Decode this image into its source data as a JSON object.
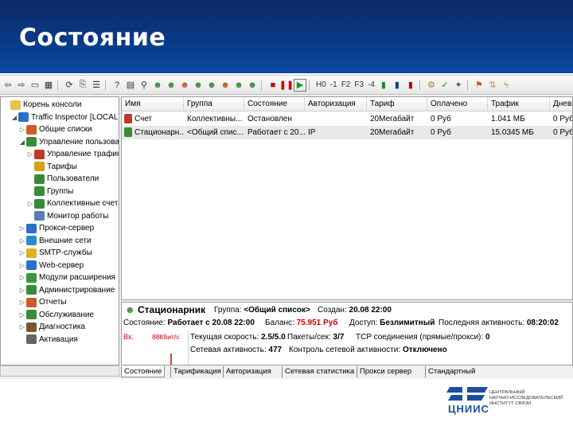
{
  "slide_title": "Состояние",
  "toolbar": {
    "items": [
      "H0",
      "-1",
      "F2",
      "F3",
      "-4"
    ]
  },
  "tree": {
    "items": [
      {
        "label": "Корень консоли",
        "icon": "folder-icon",
        "color": "#e8c44a"
      },
      {
        "label": "Traffic Inspector [LOCAL]",
        "icon": "shield-icon",
        "color": "#2a6fc9"
      },
      {
        "label": "Общие списки",
        "icon": "users-icon",
        "color": "#d05a2a"
      },
      {
        "label": "Управление пользовате",
        "icon": "users-icon",
        "color": "#3a8a3a"
      },
      {
        "label": "Управление трафик",
        "icon": "traffic-icon",
        "color": "#c0392b"
      },
      {
        "label": "Тарифы",
        "icon": "tariff-icon",
        "color": "#d4a017"
      },
      {
        "label": "Пользователи",
        "icon": "user-icon",
        "color": "#3a8a3a"
      },
      {
        "label": "Группы",
        "icon": "group-icon",
        "color": "#3a8a3a"
      },
      {
        "label": "Коллективные счета",
        "icon": "collective-icon",
        "color": "#3a8a3a"
      },
      {
        "label": "Монитор работы",
        "icon": "monitor-icon",
        "color": "#5a7fb5"
      },
      {
        "label": "Прокси-сервер",
        "icon": "proxy-icon",
        "color": "#2a6fc9"
      },
      {
        "label": "Внешние сети",
        "icon": "globe-icon",
        "color": "#2a8ad0"
      },
      {
        "label": "SMTP-службы",
        "icon": "mail-icon",
        "color": "#e0b020"
      },
      {
        "label": "Web-сервер",
        "icon": "web-icon",
        "color": "#2a6fc9"
      },
      {
        "label": "Модули расширения",
        "icon": "plugin-icon",
        "color": "#3a9a3a"
      },
      {
        "label": "Администрирование",
        "icon": "admin-icon",
        "color": "#3a8a3a"
      },
      {
        "label": "Отчеты",
        "icon": "report-icon",
        "color": "#d05a2a"
      },
      {
        "label": "Обслуживание",
        "icon": "service-icon",
        "color": "#3a8a3a"
      },
      {
        "label": "Диагностика",
        "icon": "diagnostic-icon",
        "color": "#7a5a2a"
      },
      {
        "label": "Активация",
        "icon": "key-icon",
        "color": "#666666"
      }
    ]
  },
  "grid": {
    "headers": [
      "Имя",
      "Группа",
      "Состояние",
      "Авторизация",
      "Тариф",
      "Оплачено",
      "Трафик",
      "Дневн"
    ],
    "rows": [
      [
        "Счет",
        "Коллективны...",
        "Остановлен",
        "",
        "20Мегабайт",
        "0 Руб",
        "1.041 МБ",
        "0 Руб"
      ],
      [
        "Стационарн...",
        "<Общий спис...",
        "Работает с 20....",
        "IP",
        "20Мегабайт",
        "0 Руб",
        "15.0345 МБ",
        "0 Руб"
      ]
    ]
  },
  "detail": {
    "user_name": "Стационарник",
    "group_label": "Группа:",
    "group_value": "<Общий список>",
    "created_label": "Создан:",
    "created_value": "20.08 22:00",
    "state_label": "Состояние:",
    "state_value": "Работает с 20.08 22:00",
    "balance_label": "Баланс:",
    "balance_value": "75.951 Руб",
    "access_label": "Доступ:",
    "access_value": "Безлимитный",
    "last_activity_label": "Последняя активность:",
    "last_activity_value": "08:20:02",
    "graph_in_label": "Вх.",
    "graph_rate_label": "88Кбит/с",
    "speed_label": "Текущая скорость:",
    "speed_value": "2.5/5.0",
    "packets_label": "Пакеты/сек:",
    "packets_value": "3/7",
    "tcp_label": "TCP соединения (прямые/прокси):",
    "tcp_value": "0",
    "net_activity_label": "Сетевая активность:",
    "net_activity_value": "477",
    "net_control_label": "Контроль сетевой активности:",
    "net_control_value": "Отключено"
  },
  "tabs": [
    "Состояние",
    "Тарификация",
    "Авторизация",
    "Сетевая статистика",
    "Прокси сервер",
    "Стандартный"
  ],
  "logo": {
    "word": "ЦНИИС",
    "lines": [
      "ЦЕНТРАЛЬНЫЙ",
      "НАУЧНО-ИССЛЕДОВАТЕЛЬСКИЙ",
      "ИНСТИТУТ СВЯЗИ"
    ]
  },
  "colors": {
    "header_bg": "#0a3a86",
    "accent_red": "#d00000",
    "logo_blue": "#1a4fa0"
  }
}
